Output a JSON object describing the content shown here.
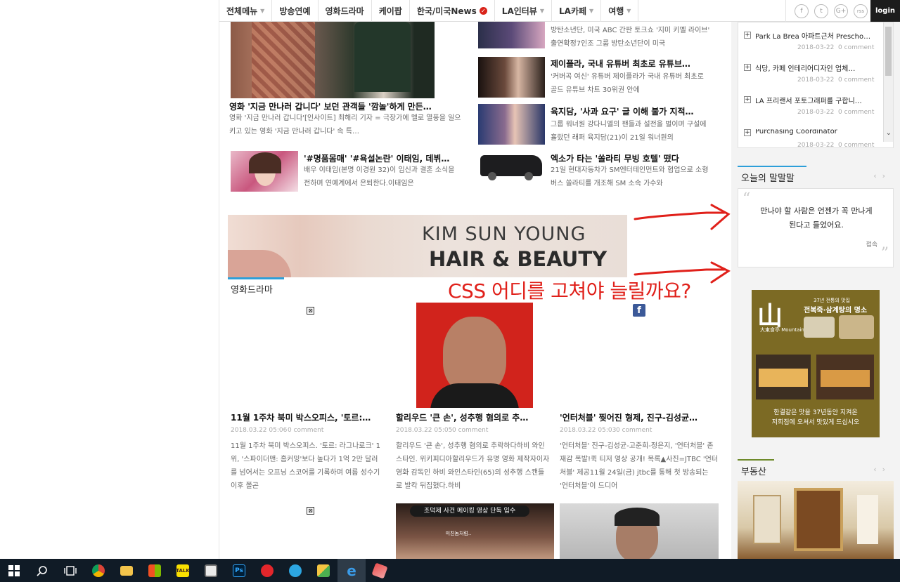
{
  "nav": {
    "items": [
      {
        "label": "전체메뉴",
        "caret": true
      },
      {
        "label": "방송연예",
        "caret": false
      },
      {
        "label": "영화드라마",
        "caret": false
      },
      {
        "label": "케이팝",
        "caret": false
      },
      {
        "label": "한국/미국News",
        "caret": false,
        "badge": true
      },
      {
        "label": "LA인터뷰",
        "caret": true
      },
      {
        "label": "LA카페",
        "caret": true
      },
      {
        "label": "여행",
        "caret": true
      }
    ],
    "social": [
      "f",
      "t",
      "G+",
      "rss"
    ],
    "login": "login"
  },
  "top_stories": {
    "main": {
      "title": "영화 '지금 만나러 갑니다' 보던 관객들 '깜놀'하게 만든…",
      "text": "영화 '지금 만나러 갑니다'[인사이트] 최해리 기자 = 극장가에 멜로 열풍을 일으키고 있는 영화 '지금 만나러 갑니다' 속 특…"
    },
    "side_left": {
      "title": "'#명품몸매' '#욕설논란' 이태임, 데뷔…",
      "text": "배우 이태임(본명 이경원 32)이 임신과 결혼 소식을 전하며 연예계에서 은퇴한다.이태임은"
    },
    "right": [
      {
        "title": "",
        "text": "방탄소년단, 미국 ABC 간판 토크쇼 '지미 키멜 라이브' 출연확정7인조 그룹 방탄소년단이 미국"
      },
      {
        "title": "제이플라, 국내 유튜버 최초로 유튜브…",
        "text": "'커버곡 여신' 유튜버 제이플라가 국내 유튜버 최초로 골드 유튜브 차트 30위권 안에"
      },
      {
        "title": "육지담, '사과 요구' 글 이해 불가 지적…",
        "text": "그룹 워너원 강다니엘의 팬들과 설전을 벌이며 구설에 휼랐던 래퍼 육지담(21)이 21일 워너원의"
      },
      {
        "title": "엑소가 타는 '쏠라티 무빙 호텔' 떴다",
        "text": "21일 현대자동차가 SM엔터테인먼트와 협업으로 소형 버스 쏠라티를 개조해 SM 소속 가수와"
      }
    ]
  },
  "banner": {
    "line1": "KIM SUN YOUNG",
    "line2": "HAIR & BEAUTY"
  },
  "section_movie": {
    "title": "영화드라마",
    "cards": [
      {
        "title": "11월 1주차 북미 박스오피스, '토르:…",
        "date": "2018.03.22 05:06",
        "comments": "0 comment",
        "text": "11월 1주차 북미 박스오피스. '토르: 라그나로크' 1위, '스파이더맨: 홈커밍'보다 높다가 1억 2만 달러를 넘어서는 오프닝 스코어를 기록하며 여름 성수기 이후 쫄곤"
      },
      {
        "title": "할리우드 '큰 손', 성추행 혐의로 추…",
        "date": "2018.03.22 05:05",
        "comments": "0 comment",
        "text": "할리우드 '큰 손', 성추행 혐의로 추락하다하비 와인스타인. 위키피디아할리우드가 유명 영화 제작자이자 영화 감독인 하비 와인스타인(65)의 성추행 스캔들로 발칵 뒤집혔다.하비"
      },
      {
        "title": "'언터처블' 찢어진 형제, 진구-김성균…",
        "date": "2018.03.22 05:03",
        "comments": "0 comment",
        "text": "'언터처블' 진구-김성균-고준희-정은지, '언터처블' 존재감 폭발!퀵 티저 영상 공개! 목록▲사진=JTBC '언터처블' 제공11월 24일(금) jtbc를 통해 첫 방송되는 '언터처블'이 드디어"
      }
    ],
    "thumb_caption": "조덕제 사건 메이킹 영상 단독 입수",
    "thumb_subcaption": "미친놈처럼.."
  },
  "sidebar": {
    "list": [
      {
        "title": "Park La Brea 아파트근처 Prescho…",
        "date": "2018-03-22",
        "comments": "0 comment"
      },
      {
        "title": "식당, 카페 인테리어디자인 업체…",
        "date": "2018-03-22",
        "comments": "0 comment"
      },
      {
        "title": "LA 프리랜서 포토그래퍼를 구합니…",
        "date": "2018-03-22",
        "comments": "0 comment"
      },
      {
        "title": "Purchasing Coordinator",
        "date": "2018-03-22",
        "comments": "0 comment"
      }
    ],
    "quote_section": {
      "title": "오늘의 말말말",
      "quote": "만나야 할 사람은 언젠가 꼭 만나게 된다고 들었어요.",
      "author": "접속"
    },
    "ad": {
      "brand": "山",
      "sub": "大東食亭 Mountain",
      "headline": "37년 전통의 맛집",
      "headline2": "전복죽·삼계탕의 명소",
      "foot1": "한결같은 맛을 37년동안 지켜온",
      "foot2": "저희집에 오셔서 맛있게 드십시오"
    },
    "realestate_title": "부동산"
  },
  "annotation": "CSS 어디를 고쳐야 늘릴까요?",
  "colors": {
    "accent": "#2d9fd9",
    "annotation": "#e0201a",
    "taskbar": "#101b26"
  }
}
